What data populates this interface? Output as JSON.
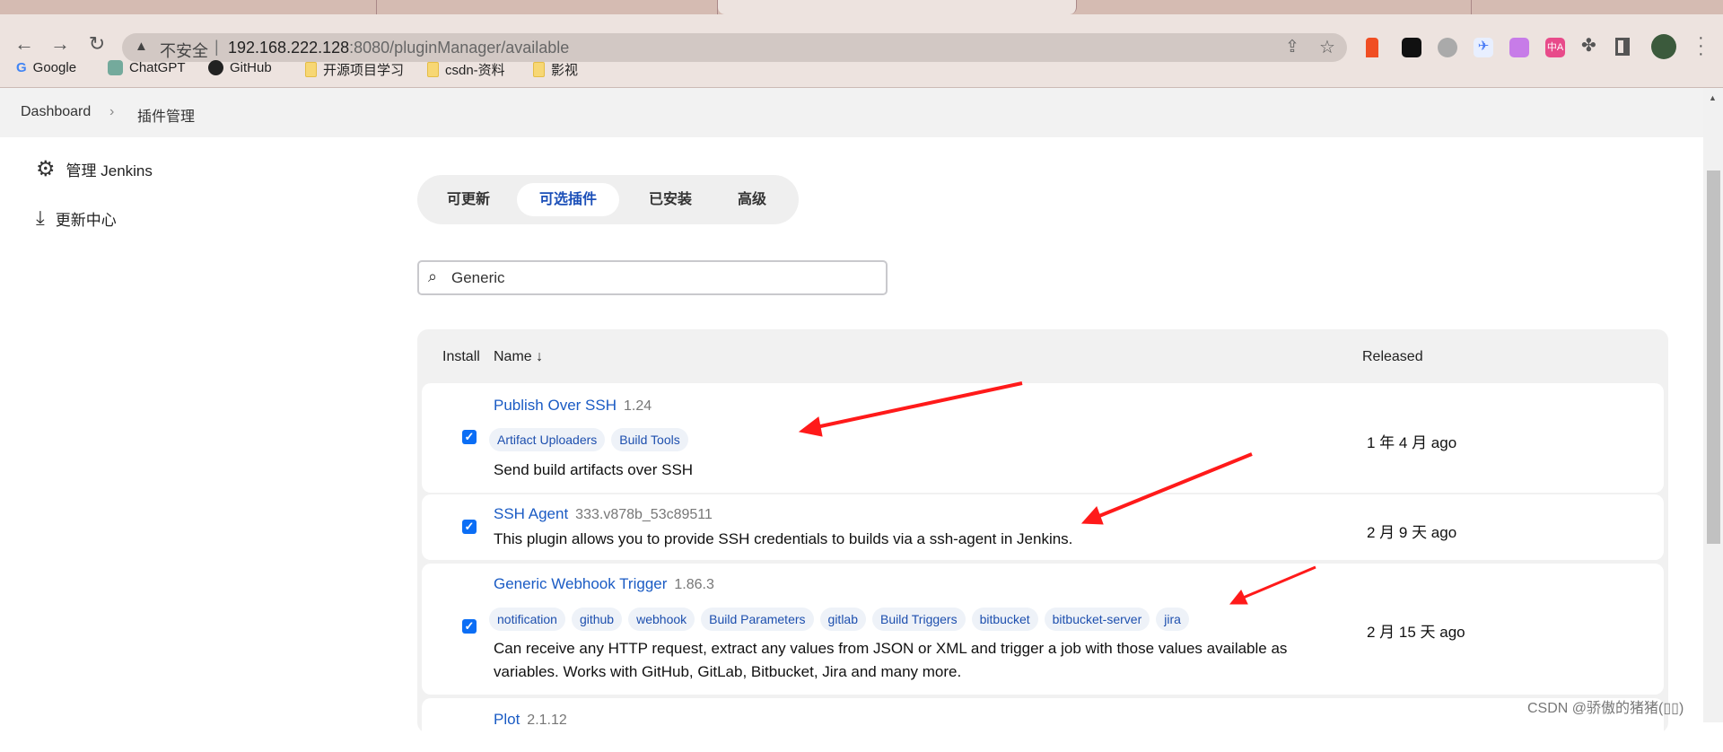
{
  "browser": {
    "insecure_label": "不安全",
    "url_host": "192.168.222.128",
    "url_rest": ":8080/pluginManager/available",
    "bookmarks": [
      "Google",
      "ChatGPT",
      "GitHub",
      "开源项目学习",
      "csdn-资料",
      "影视"
    ]
  },
  "breadcrumb": {
    "items": [
      "Dashboard",
      "插件管理"
    ]
  },
  "sidebar": {
    "items": [
      {
        "label": "管理 Jenkins",
        "icon": "gear-icon"
      },
      {
        "label": "更新中心",
        "icon": "download-icon"
      }
    ]
  },
  "tabs": [
    "可更新",
    "可选插件",
    "已安装",
    "高级"
  ],
  "active_tab": "可选插件",
  "search": {
    "value": "Generic"
  },
  "table": {
    "headers": {
      "install": "Install",
      "name": "Name ↓",
      "released": "Released"
    },
    "rows": [
      {
        "name": "Publish Over SSH",
        "version": "1.24",
        "tags": [
          "Artifact Uploaders",
          "Build Tools"
        ],
        "desc": "Send build artifacts over SSH",
        "released": "1 年 4 月 ago",
        "checked": true
      },
      {
        "name": "SSH Agent",
        "version": "333.v878b_53c89511",
        "tags": [],
        "desc": "This plugin allows you to provide SSH credentials to builds via a ssh-agent in Jenkins.",
        "released": "2 月 9 天 ago",
        "checked": true
      },
      {
        "name": "Generic Webhook Trigger",
        "version": "1.86.3",
        "tags": [
          "notification",
          "github",
          "webhook",
          "Build Parameters",
          "gitlab",
          "Build Triggers",
          "bitbucket",
          "bitbucket-server",
          "jira"
        ],
        "desc": "Can receive any HTTP request, extract any values from JSON or XML and trigger a job with those values available as variables. Works with GitHub, GitLab, Bitbucket, Jira and many more.",
        "released": "2 月 15 天 ago",
        "checked": true
      },
      {
        "name": "Plot",
        "version": "2.1.12"
      }
    ]
  },
  "watermark": "CSDN @骄傲的猪猪(▯▯)",
  "colors": {
    "link": "#1a5bc4",
    "checkbox": "#0b6ef5",
    "annotation_arrow": "#ff1a1a"
  }
}
